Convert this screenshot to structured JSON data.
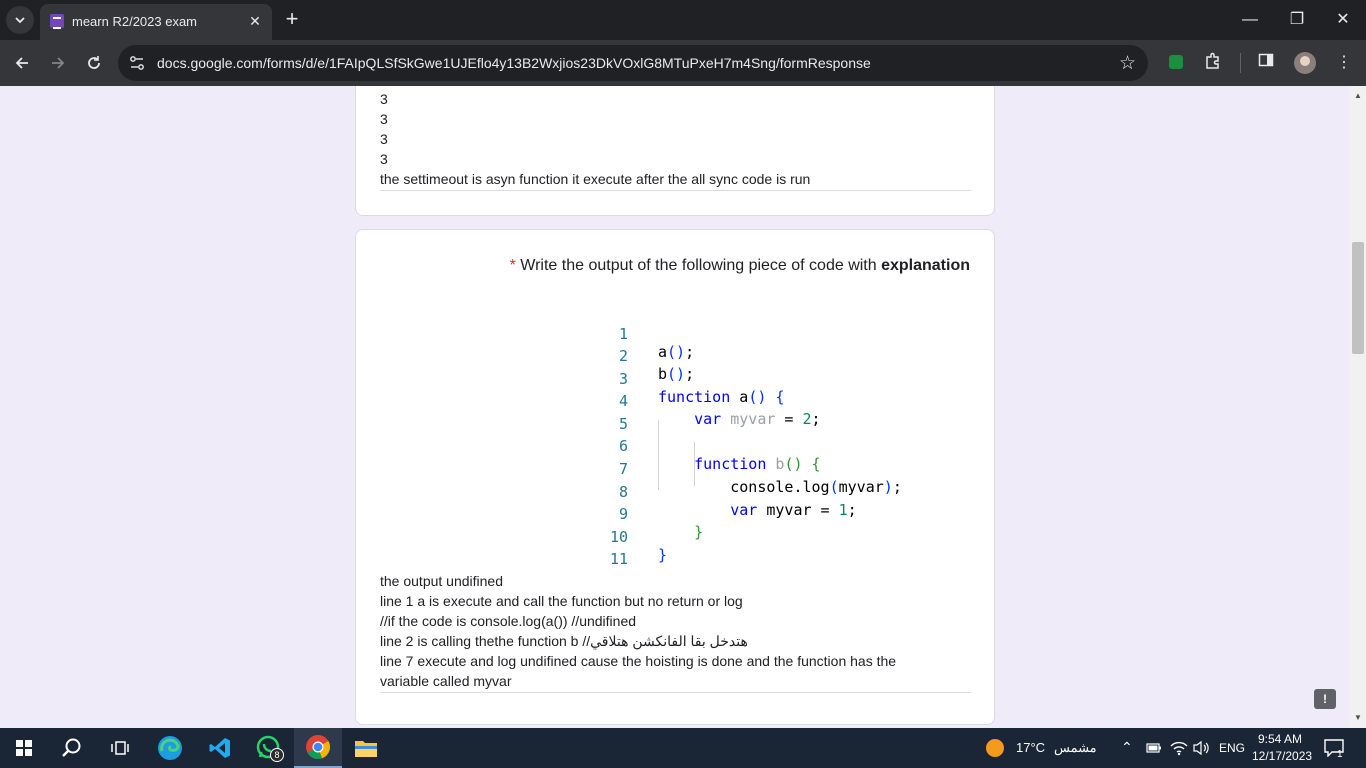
{
  "browser": {
    "tab_title": "mearn R2/2023 exam",
    "tab_close": "✕",
    "new_tab": "+",
    "url": "docs.google.com/forms/d/e/1FAIpQLSfSkGwe1UJEflo4y13B2Wxjios23DkVOxlG8MTuPxeH7m4Sng/formResponse",
    "window_controls": [
      "—",
      "❐",
      "✕"
    ]
  },
  "card1": {
    "answer_lines": [
      "3",
      "3",
      "3",
      "3",
      "the settimeout is asyn function it  execute after the all sync code is run"
    ]
  },
  "card2": {
    "required_mark": "*",
    "question_text": " Write the output of the following piece of code with ",
    "question_bold": "explanation",
    "code_line_numbers": [
      "1",
      "2",
      "3",
      "4",
      "5",
      "6",
      "7",
      "8",
      "9",
      "10",
      "11"
    ],
    "answer_lines": [
      " the output undifined",
      "line 1 a is execute and call the function but no return or log",
      "//if the code is console.log(a())         //undifined",
      "line 2  is calling thethe function b     //هتدخل بقا الفانكشن هتلاقي",
      "line 7  execute  and log undifined  cause the hoisting is done and the function has the",
      "variable called myvar"
    ]
  },
  "taskbar": {
    "whatsapp_badge": "8",
    "temperature": "17°C",
    "weather": "مشمس",
    "lang": "ENG",
    "time": "9:54 AM",
    "date": "12/17/2023",
    "notification_count": "1"
  },
  "feedback_label": "!"
}
